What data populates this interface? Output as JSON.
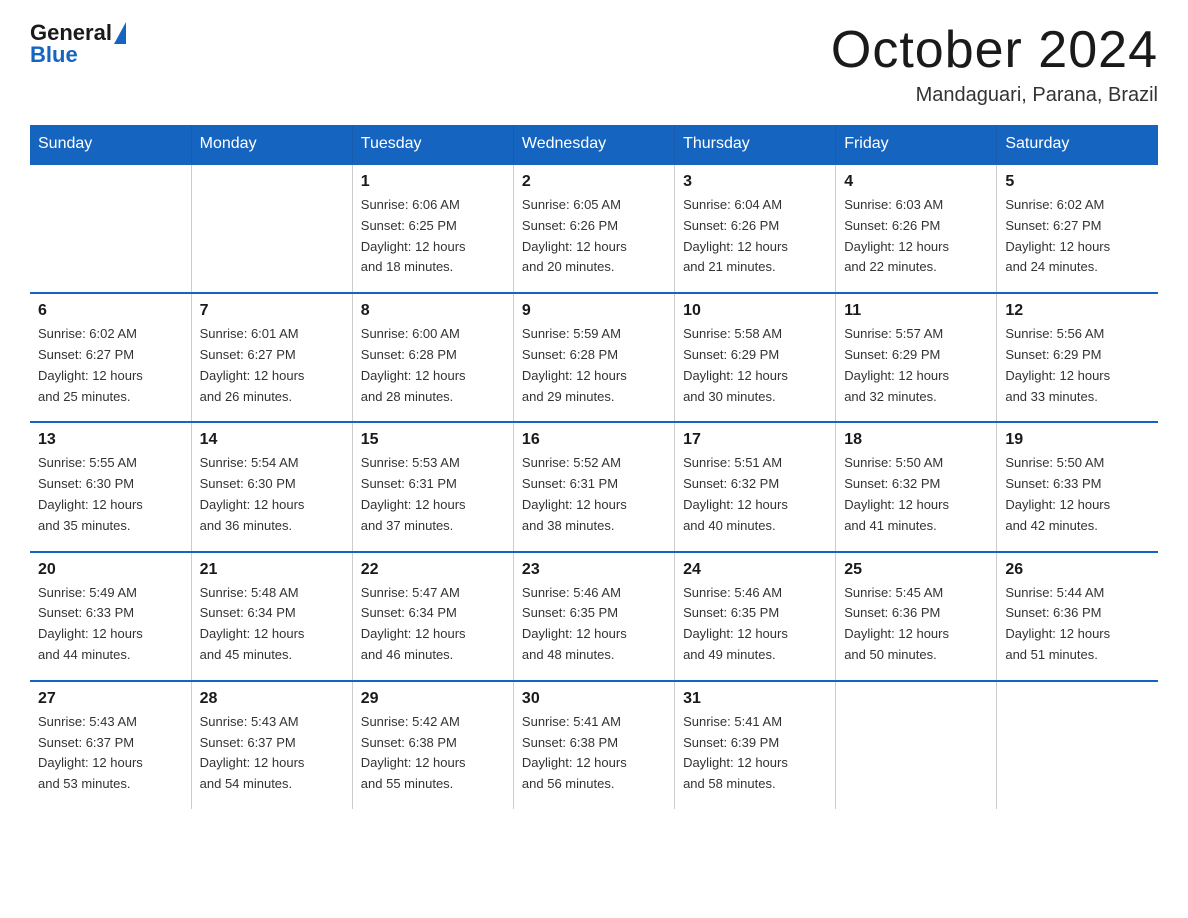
{
  "logo": {
    "text_general": "General",
    "text_blue": "Blue"
  },
  "header": {
    "title": "October 2024",
    "subtitle": "Mandaguari, Parana, Brazil"
  },
  "days_of_week": [
    "Sunday",
    "Monday",
    "Tuesday",
    "Wednesday",
    "Thursday",
    "Friday",
    "Saturday"
  ],
  "weeks": [
    [
      {
        "day": "",
        "info": ""
      },
      {
        "day": "",
        "info": ""
      },
      {
        "day": "1",
        "info": "Sunrise: 6:06 AM\nSunset: 6:25 PM\nDaylight: 12 hours\nand 18 minutes."
      },
      {
        "day": "2",
        "info": "Sunrise: 6:05 AM\nSunset: 6:26 PM\nDaylight: 12 hours\nand 20 minutes."
      },
      {
        "day": "3",
        "info": "Sunrise: 6:04 AM\nSunset: 6:26 PM\nDaylight: 12 hours\nand 21 minutes."
      },
      {
        "day": "4",
        "info": "Sunrise: 6:03 AM\nSunset: 6:26 PM\nDaylight: 12 hours\nand 22 minutes."
      },
      {
        "day": "5",
        "info": "Sunrise: 6:02 AM\nSunset: 6:27 PM\nDaylight: 12 hours\nand 24 minutes."
      }
    ],
    [
      {
        "day": "6",
        "info": "Sunrise: 6:02 AM\nSunset: 6:27 PM\nDaylight: 12 hours\nand 25 minutes."
      },
      {
        "day": "7",
        "info": "Sunrise: 6:01 AM\nSunset: 6:27 PM\nDaylight: 12 hours\nand 26 minutes."
      },
      {
        "day": "8",
        "info": "Sunrise: 6:00 AM\nSunset: 6:28 PM\nDaylight: 12 hours\nand 28 minutes."
      },
      {
        "day": "9",
        "info": "Sunrise: 5:59 AM\nSunset: 6:28 PM\nDaylight: 12 hours\nand 29 minutes."
      },
      {
        "day": "10",
        "info": "Sunrise: 5:58 AM\nSunset: 6:29 PM\nDaylight: 12 hours\nand 30 minutes."
      },
      {
        "day": "11",
        "info": "Sunrise: 5:57 AM\nSunset: 6:29 PM\nDaylight: 12 hours\nand 32 minutes."
      },
      {
        "day": "12",
        "info": "Sunrise: 5:56 AM\nSunset: 6:29 PM\nDaylight: 12 hours\nand 33 minutes."
      }
    ],
    [
      {
        "day": "13",
        "info": "Sunrise: 5:55 AM\nSunset: 6:30 PM\nDaylight: 12 hours\nand 35 minutes."
      },
      {
        "day": "14",
        "info": "Sunrise: 5:54 AM\nSunset: 6:30 PM\nDaylight: 12 hours\nand 36 minutes."
      },
      {
        "day": "15",
        "info": "Sunrise: 5:53 AM\nSunset: 6:31 PM\nDaylight: 12 hours\nand 37 minutes."
      },
      {
        "day": "16",
        "info": "Sunrise: 5:52 AM\nSunset: 6:31 PM\nDaylight: 12 hours\nand 38 minutes."
      },
      {
        "day": "17",
        "info": "Sunrise: 5:51 AM\nSunset: 6:32 PM\nDaylight: 12 hours\nand 40 minutes."
      },
      {
        "day": "18",
        "info": "Sunrise: 5:50 AM\nSunset: 6:32 PM\nDaylight: 12 hours\nand 41 minutes."
      },
      {
        "day": "19",
        "info": "Sunrise: 5:50 AM\nSunset: 6:33 PM\nDaylight: 12 hours\nand 42 minutes."
      }
    ],
    [
      {
        "day": "20",
        "info": "Sunrise: 5:49 AM\nSunset: 6:33 PM\nDaylight: 12 hours\nand 44 minutes."
      },
      {
        "day": "21",
        "info": "Sunrise: 5:48 AM\nSunset: 6:34 PM\nDaylight: 12 hours\nand 45 minutes."
      },
      {
        "day": "22",
        "info": "Sunrise: 5:47 AM\nSunset: 6:34 PM\nDaylight: 12 hours\nand 46 minutes."
      },
      {
        "day": "23",
        "info": "Sunrise: 5:46 AM\nSunset: 6:35 PM\nDaylight: 12 hours\nand 48 minutes."
      },
      {
        "day": "24",
        "info": "Sunrise: 5:46 AM\nSunset: 6:35 PM\nDaylight: 12 hours\nand 49 minutes."
      },
      {
        "day": "25",
        "info": "Sunrise: 5:45 AM\nSunset: 6:36 PM\nDaylight: 12 hours\nand 50 minutes."
      },
      {
        "day": "26",
        "info": "Sunrise: 5:44 AM\nSunset: 6:36 PM\nDaylight: 12 hours\nand 51 minutes."
      }
    ],
    [
      {
        "day": "27",
        "info": "Sunrise: 5:43 AM\nSunset: 6:37 PM\nDaylight: 12 hours\nand 53 minutes."
      },
      {
        "day": "28",
        "info": "Sunrise: 5:43 AM\nSunset: 6:37 PM\nDaylight: 12 hours\nand 54 minutes."
      },
      {
        "day": "29",
        "info": "Sunrise: 5:42 AM\nSunset: 6:38 PM\nDaylight: 12 hours\nand 55 minutes."
      },
      {
        "day": "30",
        "info": "Sunrise: 5:41 AM\nSunset: 6:38 PM\nDaylight: 12 hours\nand 56 minutes."
      },
      {
        "day": "31",
        "info": "Sunrise: 5:41 AM\nSunset: 6:39 PM\nDaylight: 12 hours\nand 58 minutes."
      },
      {
        "day": "",
        "info": ""
      },
      {
        "day": "",
        "info": ""
      }
    ]
  ]
}
